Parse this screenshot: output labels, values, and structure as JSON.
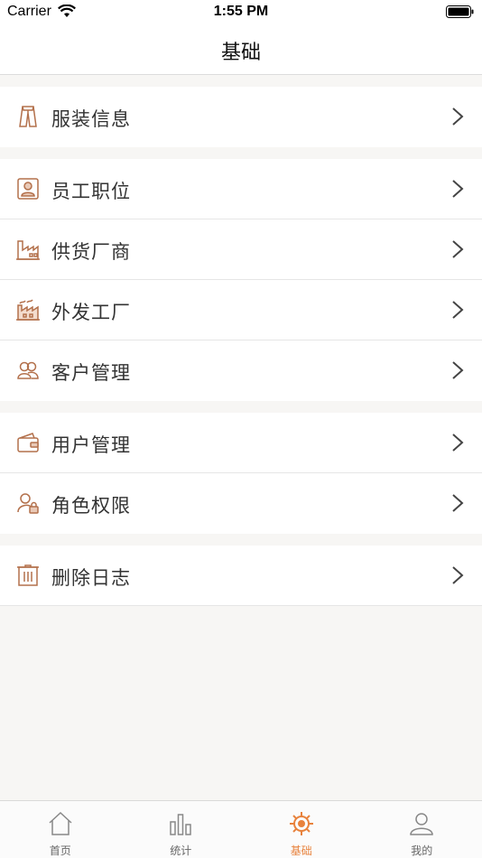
{
  "status": {
    "carrier": "Carrier",
    "time": "1:55 PM"
  },
  "nav": {
    "title": "基础"
  },
  "groups": [
    {
      "items": [
        {
          "label": "服装信息",
          "icon": "clothing-icon"
        }
      ]
    },
    {
      "items": [
        {
          "label": "员工职位",
          "icon": "employee-badge-icon"
        },
        {
          "label": "供货厂商",
          "icon": "supplier-building-icon"
        },
        {
          "label": "外发工厂",
          "icon": "factory-icon"
        },
        {
          "label": "客户管理",
          "icon": "customers-icon"
        }
      ]
    },
    {
      "items": [
        {
          "label": "用户管理",
          "icon": "wallet-icon"
        },
        {
          "label": "角色权限",
          "icon": "user-lock-icon"
        }
      ]
    },
    {
      "items": [
        {
          "label": "删除日志",
          "icon": "trash-log-icon"
        }
      ]
    }
  ],
  "tabs": [
    {
      "label": "首页",
      "icon": "home-icon",
      "active": false
    },
    {
      "label": "统计",
      "icon": "bar-chart-icon",
      "active": false
    },
    {
      "label": "基础",
      "icon": "gear-icon",
      "active": true
    },
    {
      "label": "我的",
      "icon": "user-icon",
      "active": false
    }
  ],
  "colors": {
    "accent": "#e8823c",
    "icon": "#b3704b",
    "background": "#f7f6f4"
  }
}
